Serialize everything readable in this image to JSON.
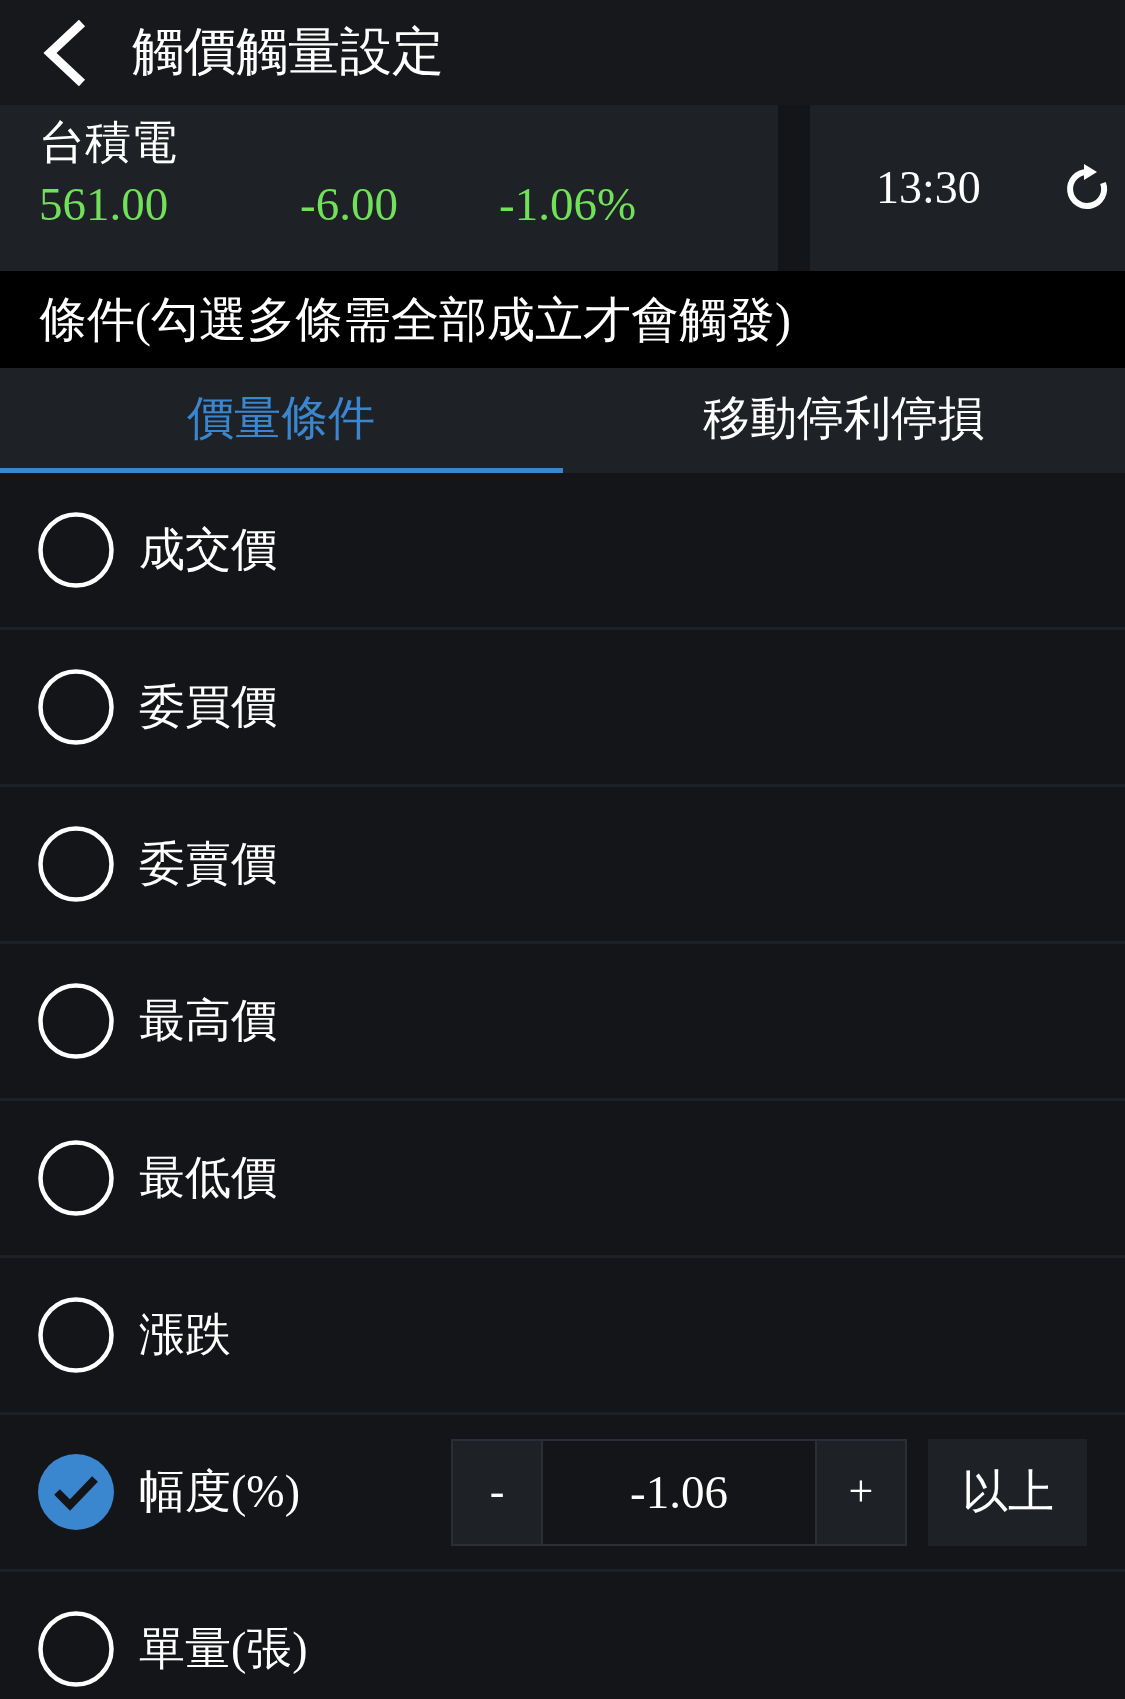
{
  "header": {
    "title": "觸價觸量設定"
  },
  "quote": {
    "name": "台積電",
    "price": "561.00",
    "change": "-6.00",
    "change_percent": "-1.06%",
    "time": "13:30"
  },
  "condition_bar": {
    "text": "條件(勾選多條需全部成立才會觸發)"
  },
  "tabs": [
    {
      "label": "價量條件",
      "selected": true
    },
    {
      "label": "移動停利停損",
      "selected": false
    }
  ],
  "conditions": [
    {
      "label": "成交價",
      "checked": false
    },
    {
      "label": "委買價",
      "checked": false
    },
    {
      "label": "委賣價",
      "checked": false
    },
    {
      "label": "最高價",
      "checked": false
    },
    {
      "label": "最低價",
      "checked": false
    },
    {
      "label": "漲跌",
      "checked": false
    },
    {
      "label": "幅度(%)",
      "checked": true,
      "stepper": {
        "minus": "-",
        "value": "-1.06",
        "plus": "+",
        "direction": "以上"
      }
    },
    {
      "label": "單量(張)",
      "checked": false
    }
  ]
}
